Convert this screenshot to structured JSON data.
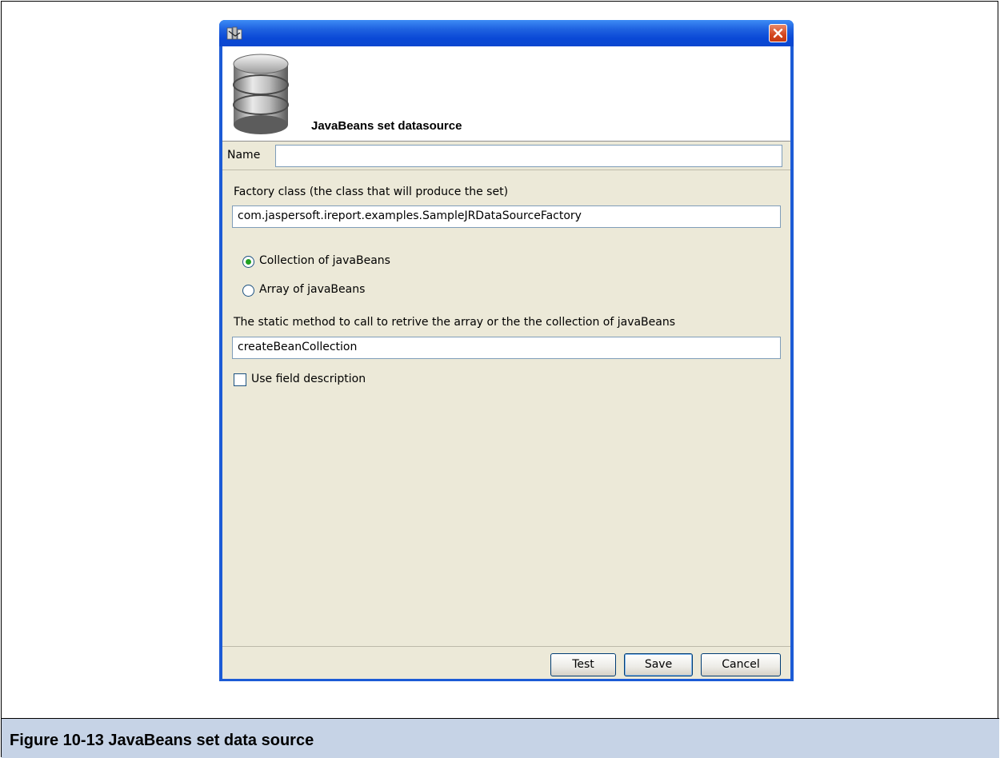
{
  "dialog": {
    "header_title": "JavaBeans set datasource",
    "name_label": "Name",
    "name_value": "",
    "factory_label": "Factory class (the class that will produce the set)",
    "factory_value": "com.jaspersoft.ireport.examples.SampleJRDataSourceFactory",
    "radio_collection_label": "Collection of javaBeans",
    "radio_array_label": "Array of javaBeans",
    "selected_option": "Collection of javaBeans",
    "method_label": "The static method to call to retrive the array or the the collection of javaBeans",
    "method_value": "createBeanCollection",
    "use_field_description_label": "Use field description",
    "use_field_description_checked": false,
    "buttons": {
      "test": "Test",
      "save": "Save",
      "cancel": "Cancel"
    }
  },
  "caption": "Figure 10-13  JavaBeans set data source",
  "icons": [
    "app-icon",
    "close-icon",
    "database-icon"
  ],
  "colors": {
    "titlebar": "#0a48d6",
    "dialog_bg": "#ece9d8",
    "caption_bg": "#c6d3e6",
    "close_button": "#d3451d"
  }
}
